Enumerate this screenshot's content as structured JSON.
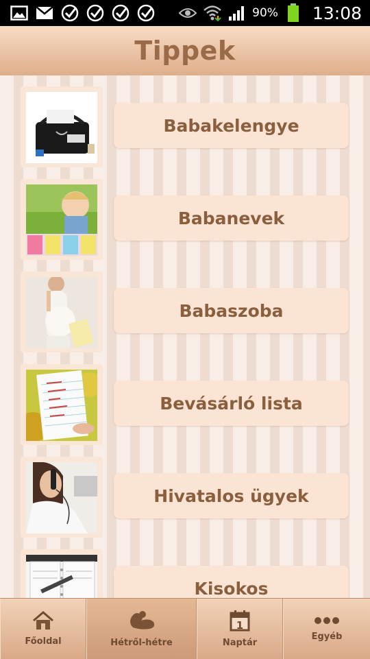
{
  "status_bar": {
    "left_icons": [
      "image-icon",
      "mail-icon",
      "check-icon",
      "check-icon",
      "check-icon",
      "check-icon"
    ],
    "right_icons": [
      "eye-icon",
      "wifi-icon",
      "signal-icon"
    ],
    "battery_text": "90%",
    "time": "13:08"
  },
  "header": {
    "title": "Tippek"
  },
  "items": [
    {
      "label": "Babakelengye",
      "icon": "baby-bag-photo"
    },
    {
      "label": "Babanevek",
      "icon": "baby-letters-photo"
    },
    {
      "label": "Babaszoba",
      "icon": "pregnant-woman-photo"
    },
    {
      "label": "Bevásárló lista",
      "icon": "shopping-list-photo"
    },
    {
      "label": "Hivatalos ügyek",
      "icon": "woman-phone-photo"
    },
    {
      "label": "Kisokos",
      "icon": "planner-photo"
    }
  ],
  "bottom_nav": [
    {
      "label": "Főoldal",
      "icon": "home-icon"
    },
    {
      "label": "Hétről-hétre",
      "icon": "fetus-icon",
      "active": true
    },
    {
      "label": "Naptár",
      "icon": "calendar-icon"
    },
    {
      "label": "Egyéb",
      "icon": "more-icon"
    }
  ]
}
